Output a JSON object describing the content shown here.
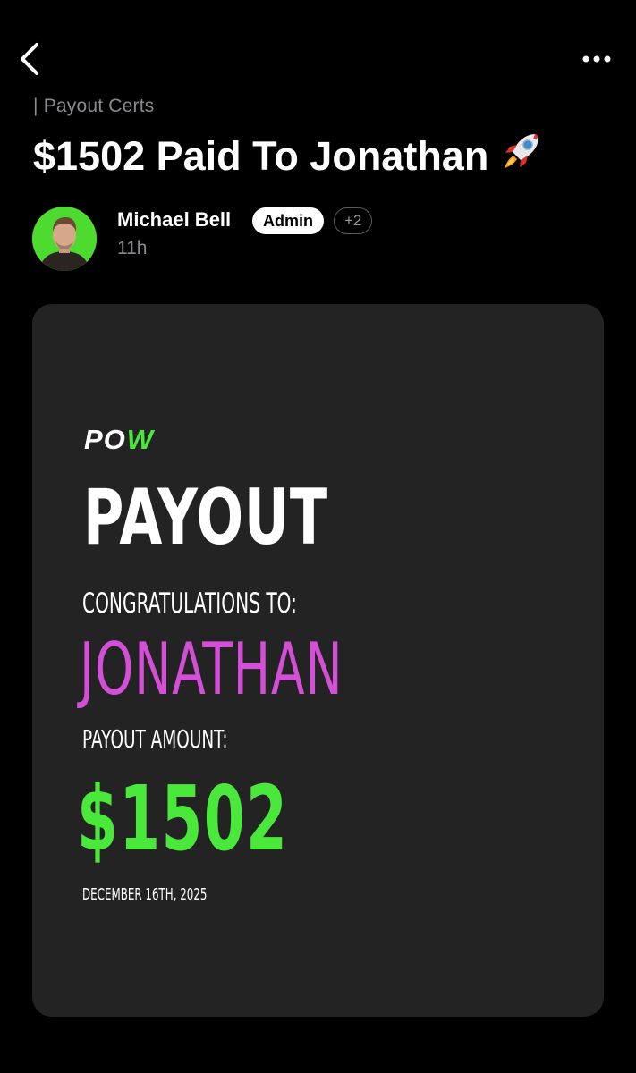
{
  "nav": {
    "back_icon": "chevron-left-icon",
    "more_icon": "more-horizontal-icon"
  },
  "post": {
    "category": "| Payout Certs",
    "title": "$1502 Paid To Jonathan",
    "title_emoji": "🚀",
    "author": {
      "name": "Michael Bell",
      "badge": "Admin",
      "extra_badges": "+2",
      "avatar_bg": "#4ddb2f"
    },
    "timestamp": "11h"
  },
  "certificate": {
    "logo_po": "PO",
    "logo_w": "W",
    "heading": "PAYOUT",
    "congrats_label": "CONGRATULATIONS TO:",
    "recipient": "JONATHAN",
    "amount_label": "PAYOUT AMOUNT:",
    "amount": "$1502",
    "date": "DECEMBER 16TH, 2025",
    "colors": {
      "background": "#232323",
      "recipient": "#d24fd6",
      "amount": "#4ae83a",
      "logo_accent": "#4ae83a"
    }
  }
}
